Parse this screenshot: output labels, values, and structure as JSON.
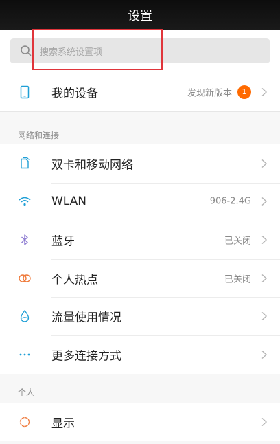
{
  "title": "设置",
  "search": {
    "placeholder": "搜索系统设置项"
  },
  "device_row": {
    "label": "我的设备",
    "value": "发现新版本",
    "badge": "1"
  },
  "sections": [
    {
      "header": "网络和连接",
      "items": [
        {
          "label": "双卡和移动网络",
          "value": ""
        },
        {
          "label": "WLAN",
          "value": "906-2.4G"
        },
        {
          "label": "蓝牙",
          "value": "已关闭"
        },
        {
          "label": "个人热点",
          "value": "已关闭"
        },
        {
          "label": "流量使用情况",
          "value": ""
        },
        {
          "label": "更多连接方式",
          "value": ""
        }
      ]
    },
    {
      "header": "个人",
      "items": [
        {
          "label": "显示",
          "value": ""
        }
      ]
    }
  ],
  "colors": {
    "accent_blue": "#1f9fd6",
    "badge_orange": "#ff6a00",
    "hotspot_orange": "#ef7a3b",
    "highlight_red": "#e0353b",
    "bluetooth_purple": "#8c7ad1"
  }
}
